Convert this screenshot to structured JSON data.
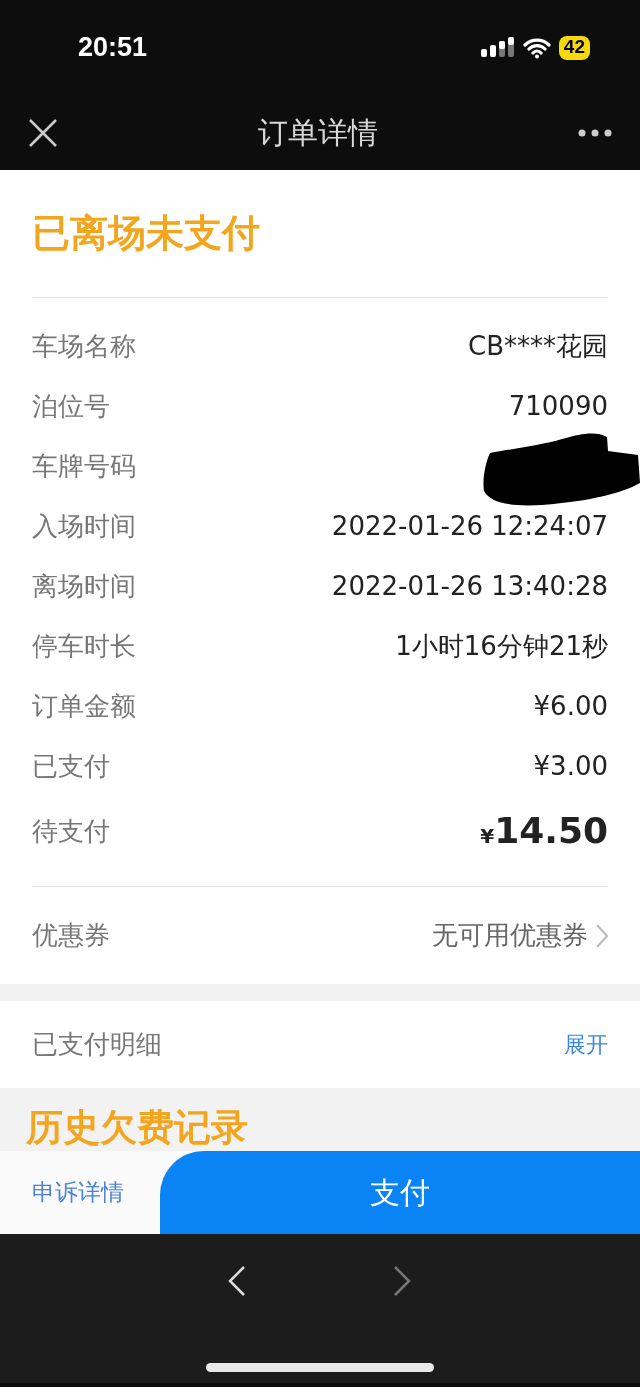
{
  "status_bar": {
    "time": "20:51",
    "battery": "42"
  },
  "nav": {
    "title": "订单详情"
  },
  "order": {
    "status": "已离场未支付",
    "rows": [
      {
        "kind": "text",
        "label": "车场名称",
        "value": "CB****花园"
      },
      {
        "kind": "text",
        "label": "泊位号",
        "value": "710090"
      },
      {
        "kind": "redacted",
        "label": "车牌号码"
      },
      {
        "kind": "text",
        "label": "入场时间",
        "value": "2022-01-26 12:24:07"
      },
      {
        "kind": "text",
        "label": "离场时间",
        "value": "2022-01-26 13:40:28"
      },
      {
        "kind": "text",
        "label": "停车时长",
        "value": "1小时16分钟21秒"
      },
      {
        "kind": "text",
        "label": "订单金额",
        "value": "¥6.00"
      },
      {
        "kind": "text",
        "label": "已支付",
        "value": "¥3.00"
      },
      {
        "kind": "total",
        "label": "待支付",
        "currency": "¥",
        "value": "14.50"
      }
    ],
    "coupon": {
      "label": "优惠券",
      "value": "无可用优惠券"
    }
  },
  "paid_details": {
    "label": "已支付明细",
    "action": "展开"
  },
  "history": {
    "title": "历史欠费记录"
  },
  "bottom_bar": {
    "appeal": "申诉详情",
    "pay": "支付"
  }
}
